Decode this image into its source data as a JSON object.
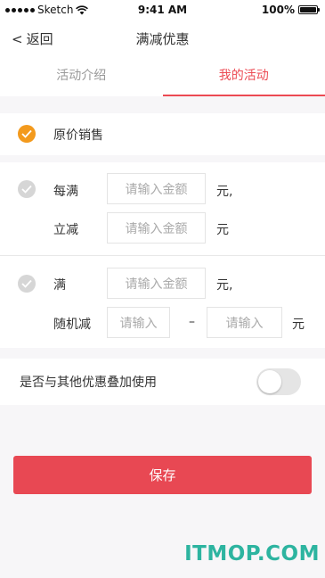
{
  "status_bar": {
    "carrier": "Sketch",
    "time": "9:41 AM",
    "battery": "100%",
    "battery_level": 1.0
  },
  "nav": {
    "back_label": "返回",
    "back_glyph": "<",
    "title": "满减优惠"
  },
  "tabs": [
    {
      "label": "活动介绍",
      "active": false
    },
    {
      "label": "我的活动",
      "active": true
    }
  ],
  "option_original": {
    "label": "原价销售",
    "checked": true
  },
  "option_every": {
    "checked": false,
    "label": "每满",
    "amount_placeholder": "请输入金额",
    "unit": "元,",
    "reduce_label": "立减",
    "reduce_placeholder": "请输入金额",
    "reduce_unit": "元"
  },
  "option_random": {
    "checked": false,
    "label": "满",
    "amount_placeholder": "请输入金额",
    "unit": "元,",
    "random_label": "随机减",
    "min_placeholder": "请输入",
    "dash": "–",
    "max_placeholder": "请输入",
    "range_unit": "元"
  },
  "stack": {
    "label": "是否与其他优惠叠加使用",
    "enabled": false
  },
  "save_label": "保存",
  "watermark": "ITMOP.COM",
  "colors": {
    "accent": "#ec4a53",
    "radio_checked": "#f39a1d",
    "radio_unchecked": "#d6d6d6",
    "watermark": "#2db4a0"
  }
}
